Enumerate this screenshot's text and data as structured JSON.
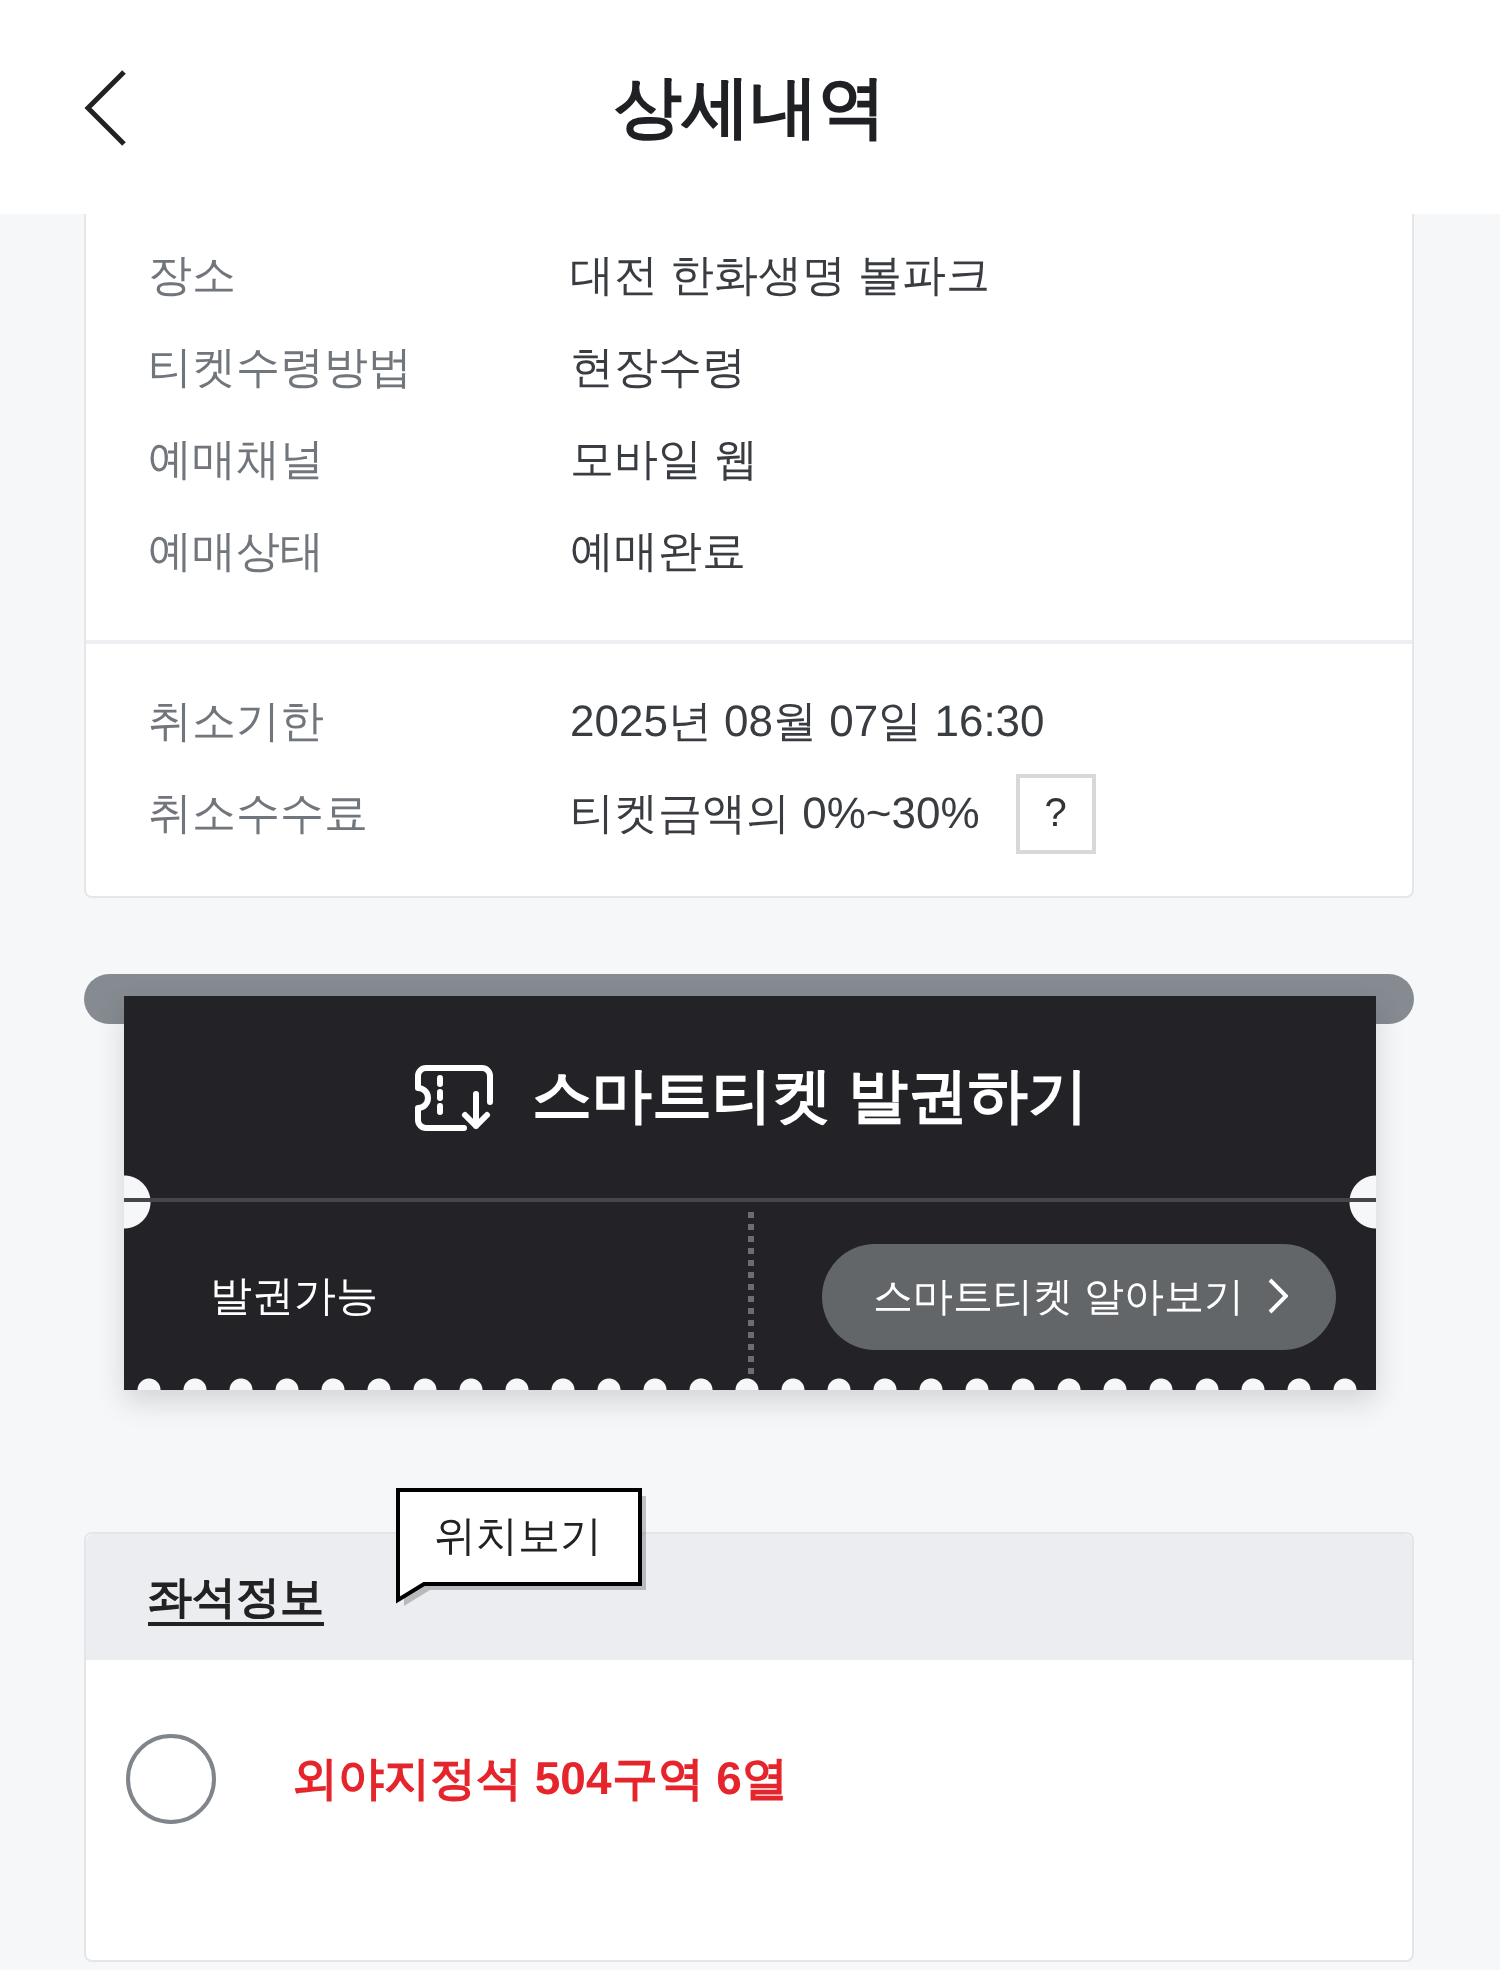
{
  "header": {
    "title": "상세내역"
  },
  "booking_info": {
    "rows": [
      {
        "label": "장소",
        "value": "대전 한화생명 볼파크"
      },
      {
        "label": "티켓수령방법",
        "value": "현장수령"
      },
      {
        "label": "예매채널",
        "value": "모바일 웹"
      },
      {
        "label": "예매상태",
        "value": "예매완료"
      }
    ]
  },
  "cancellation": {
    "rows": [
      {
        "label": "취소기한",
        "value": "2025년 08월 07일 16:30"
      },
      {
        "label": "취소수수료",
        "value": "티켓금액의 0%~30%",
        "help_button": "?"
      }
    ]
  },
  "smart_ticket": {
    "title": "스마트티켓 발권하기",
    "status": "발권가능",
    "info_button": "스마트티켓 알아보기"
  },
  "seat_info": {
    "title": "좌석정보",
    "tooltip": "위치보기",
    "seats": [
      {
        "label": "외야지정석 504구역 6열",
        "selected": false
      }
    ]
  }
}
